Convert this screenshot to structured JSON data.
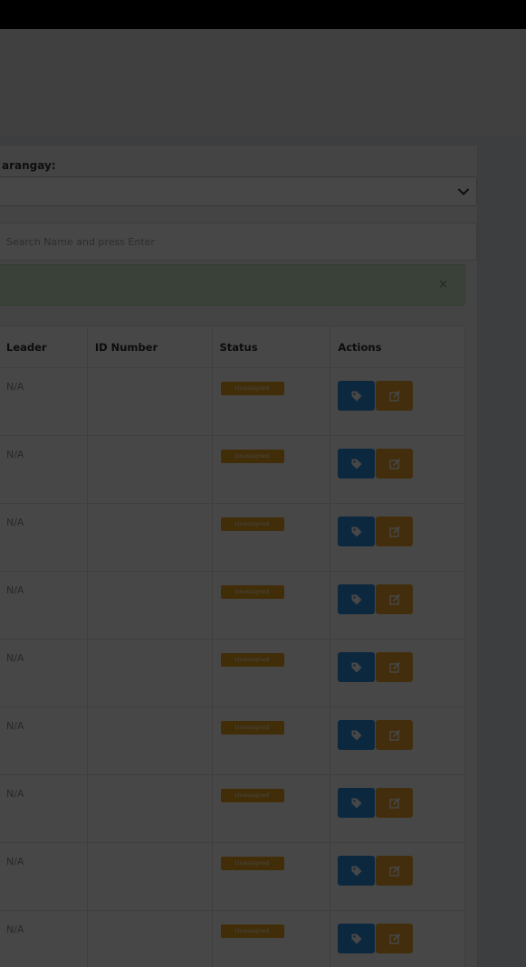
{
  "filter": {
    "barangay_label": "arangay:",
    "barangay_selected": ""
  },
  "search": {
    "placeholder": "Search Name and press Enter"
  },
  "alert": {
    "close_glyph": "×"
  },
  "table": {
    "columns": [
      "Leader",
      "ID Number",
      "Status",
      "Actions"
    ],
    "rows": [
      {
        "leader": "N/A",
        "id_number": "",
        "status": "Unassigned"
      },
      {
        "leader": "N/A",
        "id_number": "",
        "status": "Unassigned"
      },
      {
        "leader": "N/A",
        "id_number": "",
        "status": "Unassigned"
      },
      {
        "leader": "N/A",
        "id_number": "",
        "status": "Unassigned"
      },
      {
        "leader": "N/A",
        "id_number": "",
        "status": "Unassigned"
      },
      {
        "leader": "N/A",
        "id_number": "",
        "status": "Unassigned"
      },
      {
        "leader": "N/A",
        "id_number": "",
        "status": "Unassigned"
      },
      {
        "leader": "N/A",
        "id_number": "",
        "status": "Unassigned"
      },
      {
        "leader": "N/A",
        "id_number": "",
        "status": "Unassigned"
      }
    ]
  },
  "icons": {
    "select_arrow": "chevron-down-icon",
    "tag_action": "tag-icon",
    "edit_action": "edit-icon"
  },
  "colors": {
    "status_badge": "#e9a11c",
    "tag_button": "#2d8fe0",
    "edit_button": "#eca62c",
    "alert_bg": "#cfe9cc",
    "overlay": "rgba(0,0,0,0.72)"
  }
}
